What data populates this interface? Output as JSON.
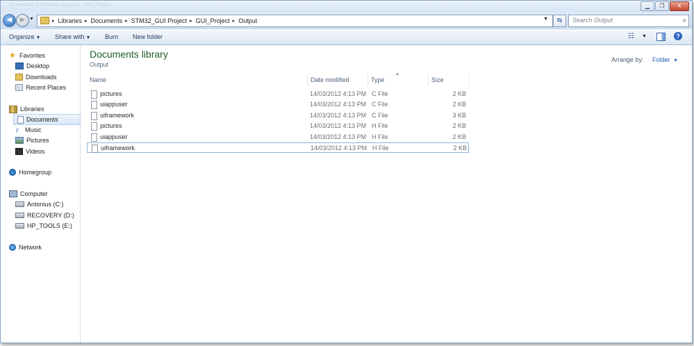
{
  "window": {
    "title": "Screenshot of Windows Explorer - GUI_Project",
    "controls": {
      "minimize": "▁",
      "maximize": "❐",
      "close": "✕"
    }
  },
  "address": {
    "recent_dropdown": "▼",
    "breadcrumbs": [
      "Libraries",
      "Documents",
      "STM32_GUI Project",
      "GUI_Project",
      "Output"
    ],
    "separator": "▸",
    "dropdown": "▼",
    "refresh_glyph": "⇆"
  },
  "search": {
    "placeholder": "Search Output",
    "icon": "⌕"
  },
  "commands": {
    "organize": "Organize",
    "share_with": "Share with",
    "burn": "Burn",
    "new_folder": "New folder",
    "dropdown_glyph": "▼",
    "view_glyph": "☷",
    "help_glyph": "?"
  },
  "nav": {
    "favorites": "Favorites",
    "desktop": "Desktop",
    "downloads": "Downloads",
    "recent_places": "Recent Places",
    "libraries": "Libraries",
    "documents": "Documents",
    "music": "Music",
    "pictures": "Pictures",
    "videos": "Videos",
    "homegroup": "Homegroup",
    "computer": "Computer",
    "drive_c": "Antonius (C:)",
    "drive_d": "RECOVERY (D:)",
    "drive_e": "HP_TOOLS (E:)",
    "network": "Network"
  },
  "library": {
    "title": "Documents library",
    "subtitle": "Output"
  },
  "arrange": {
    "label": "Arrange by:",
    "value": "Folder",
    "dropdown_glyph": "▼"
  },
  "columns": {
    "name": "Name",
    "date": "Date modified",
    "type": "Type",
    "size": "Size",
    "sort_glyph": "▲"
  },
  "files": [
    {
      "name": "pictures",
      "date": "14/03/2012 4:13 PM",
      "type": "C File",
      "size": "2 KB"
    },
    {
      "name": "uiappuser",
      "date": "14/03/2012 4:13 PM",
      "type": "C File",
      "size": "2 KB"
    },
    {
      "name": "uiframework",
      "date": "14/03/2012 4:13 PM",
      "type": "C File",
      "size": "3 KB"
    },
    {
      "name": "pictures",
      "date": "14/03/2012 4:13 PM",
      "type": "H File",
      "size": "2 KB"
    },
    {
      "name": "uiappuser",
      "date": "14/03/2012 4:13 PM",
      "type": "H File",
      "size": "2 KB"
    },
    {
      "name": "uiframework",
      "date": "14/03/2012 4:13 PM",
      "type": "H File",
      "size": "2 KB"
    }
  ]
}
